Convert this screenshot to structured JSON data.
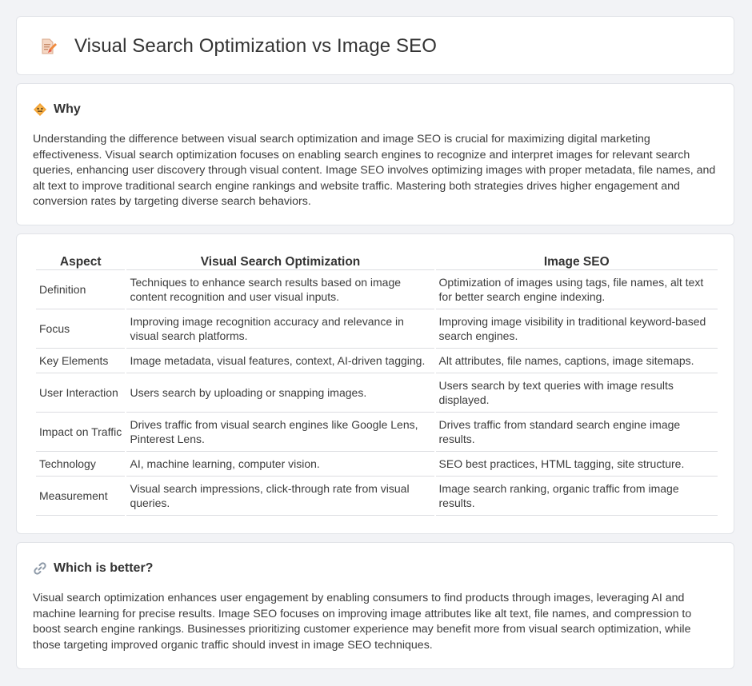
{
  "header": {
    "title": "Visual Search Optimization vs Image SEO",
    "icon": "document-pen-icon"
  },
  "why": {
    "title": "Why",
    "icon": "diamond-sign-icon",
    "body": "Understanding the difference between visual search optimization and image SEO is crucial for maximizing digital marketing effectiveness. Visual search optimization focuses on enabling search engines to recognize and interpret images for relevant search queries, enhancing user discovery through visual content. Image SEO involves optimizing images with proper metadata, file names, and alt text to improve traditional search engine rankings and website traffic. Mastering both strategies drives higher engagement and conversion rates by targeting diverse search behaviors."
  },
  "table": {
    "headers": [
      "Aspect",
      "Visual Search Optimization",
      "Image SEO"
    ],
    "rows": [
      [
        "Definition",
        "Techniques to enhance search results based on image content recognition and user visual inputs.",
        "Optimization of images using tags, file names, alt text for better search engine indexing."
      ],
      [
        "Focus",
        "Improving image recognition accuracy and relevance in visual search platforms.",
        "Improving image visibility in traditional keyword-based search engines."
      ],
      [
        "Key Elements",
        "Image metadata, visual features, context, AI-driven tagging.",
        "Alt attributes, file names, captions, image sitemaps."
      ],
      [
        "User Interaction",
        "Users search by uploading or snapping images.",
        "Users search by text queries with image results displayed."
      ],
      [
        "Impact on Traffic",
        "Drives traffic from visual search engines like Google Lens, Pinterest Lens.",
        "Drives traffic from standard search engine image results."
      ],
      [
        "Technology",
        "AI, machine learning, computer vision.",
        "SEO best practices, HTML tagging, site structure."
      ],
      [
        "Measurement",
        "Visual search impressions, click-through rate from visual queries.",
        "Image search ranking, organic traffic from image results."
      ]
    ]
  },
  "better": {
    "title": "Which is better?",
    "icon": "link-icon",
    "body": "Visual search optimization enhances user engagement by enabling consumers to find products through images, leveraging AI and machine learning for precise results. Image SEO focuses on improving image attributes like alt text, file names, and compression to boost search engine rankings. Businesses prioritizing customer experience may benefit more from visual search optimization, while those targeting improved organic traffic should invest in image SEO techniques."
  },
  "colors": {
    "accent_orange": "#f08a3c",
    "page_bg": "#f2f3f6",
    "card_border": "#e1e3e8"
  }
}
